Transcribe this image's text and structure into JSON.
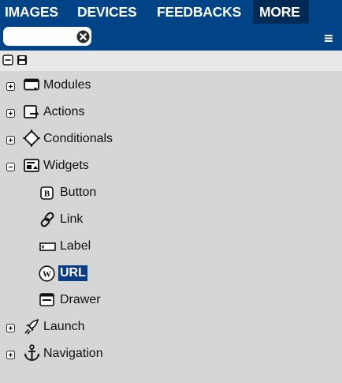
{
  "tabs": [
    {
      "label": "IMAGES"
    },
    {
      "label": "DEVICES"
    },
    {
      "label": "FEEDBACKS"
    },
    {
      "label": "MORE",
      "active": true
    }
  ],
  "search": {
    "value": "",
    "placeholder": ""
  },
  "colors": {
    "header": "#004488",
    "active_tab": "#002a54",
    "selection": "#0a3d86",
    "panel": "#d6d6d6"
  },
  "tree": {
    "items": [
      {
        "label": "Modules",
        "icon": "window-icon",
        "expanded": false
      },
      {
        "label": "Actions",
        "icon": "action-arrow-icon",
        "expanded": false
      },
      {
        "label": "Conditionals",
        "icon": "diamond-icon",
        "expanded": false
      },
      {
        "label": "Widgets",
        "icon": "widget-icon",
        "expanded": true,
        "children": [
          {
            "label": "Button",
            "icon": "button-b-icon"
          },
          {
            "label": "Link",
            "icon": "chain-link-icon"
          },
          {
            "label": "Label",
            "icon": "label-rect-icon"
          },
          {
            "label": "URL",
            "icon": "wordpress-w-icon",
            "selected": true
          },
          {
            "label": "Drawer",
            "icon": "drawer-icon"
          }
        ]
      },
      {
        "label": "Launch",
        "icon": "rocket-icon",
        "expanded": false
      },
      {
        "label": "Navigation",
        "icon": "anchor-icon",
        "expanded": false
      }
    ]
  }
}
